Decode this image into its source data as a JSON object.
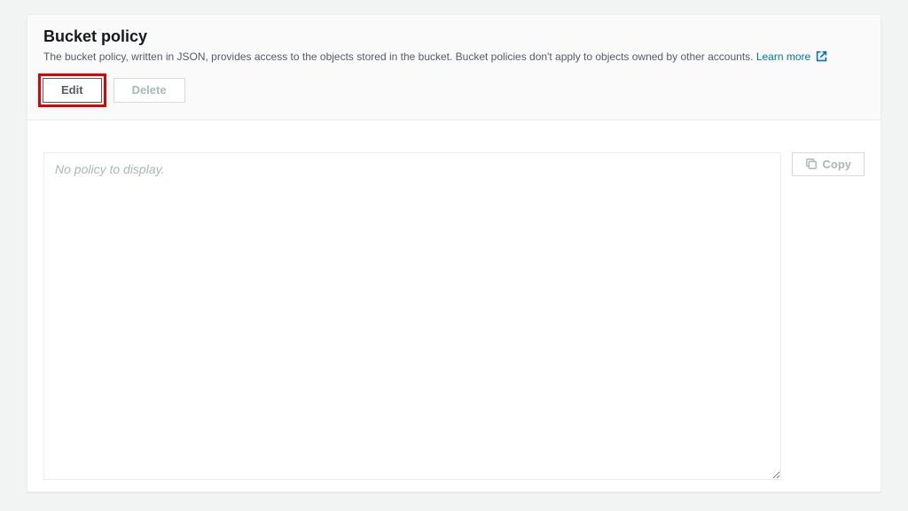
{
  "header": {
    "title": "Bucket policy",
    "description": "The bucket policy, written in JSON, provides access to the objects stored in the bucket. Bucket policies don't apply to objects owned by other accounts. ",
    "learn_more": "Learn more"
  },
  "buttons": {
    "edit": "Edit",
    "delete": "Delete",
    "copy": "Copy"
  },
  "policy": {
    "placeholder": "No policy to display."
  }
}
